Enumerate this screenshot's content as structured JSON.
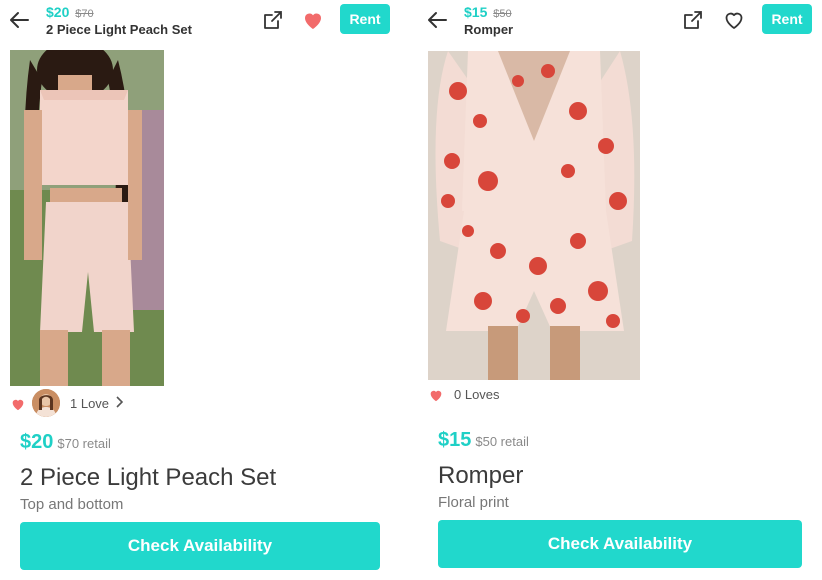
{
  "left": {
    "header": {
      "price": "$20",
      "old_price": "$70",
      "title": "2 Piece Light Peach Set",
      "rent_label": "Rent"
    },
    "loves": {
      "text": "1 Love",
      "favorited": true
    },
    "detail": {
      "price": "$20",
      "retail": "$70 retail",
      "title": "2 Piece Light Peach Set",
      "description": "Top and bottom"
    },
    "cta": "Check Availability"
  },
  "right": {
    "header": {
      "price": "$15",
      "old_price": "$50",
      "title": "Romper",
      "rent_label": "Rent"
    },
    "loves": {
      "text": "0 Loves",
      "favorited": false
    },
    "detail": {
      "price": "$15",
      "retail": "$50 retail",
      "title": "Romper",
      "description": "Floral print"
    },
    "cta": "Check Availability"
  },
  "colors": {
    "accent": "#21d8cc",
    "price_teal": "#1fd0c6",
    "heart_red": "#f26b6b"
  },
  "icons": {
    "back": "arrow-left-icon",
    "share": "external-link-icon",
    "favorite": "heart-icon"
  }
}
